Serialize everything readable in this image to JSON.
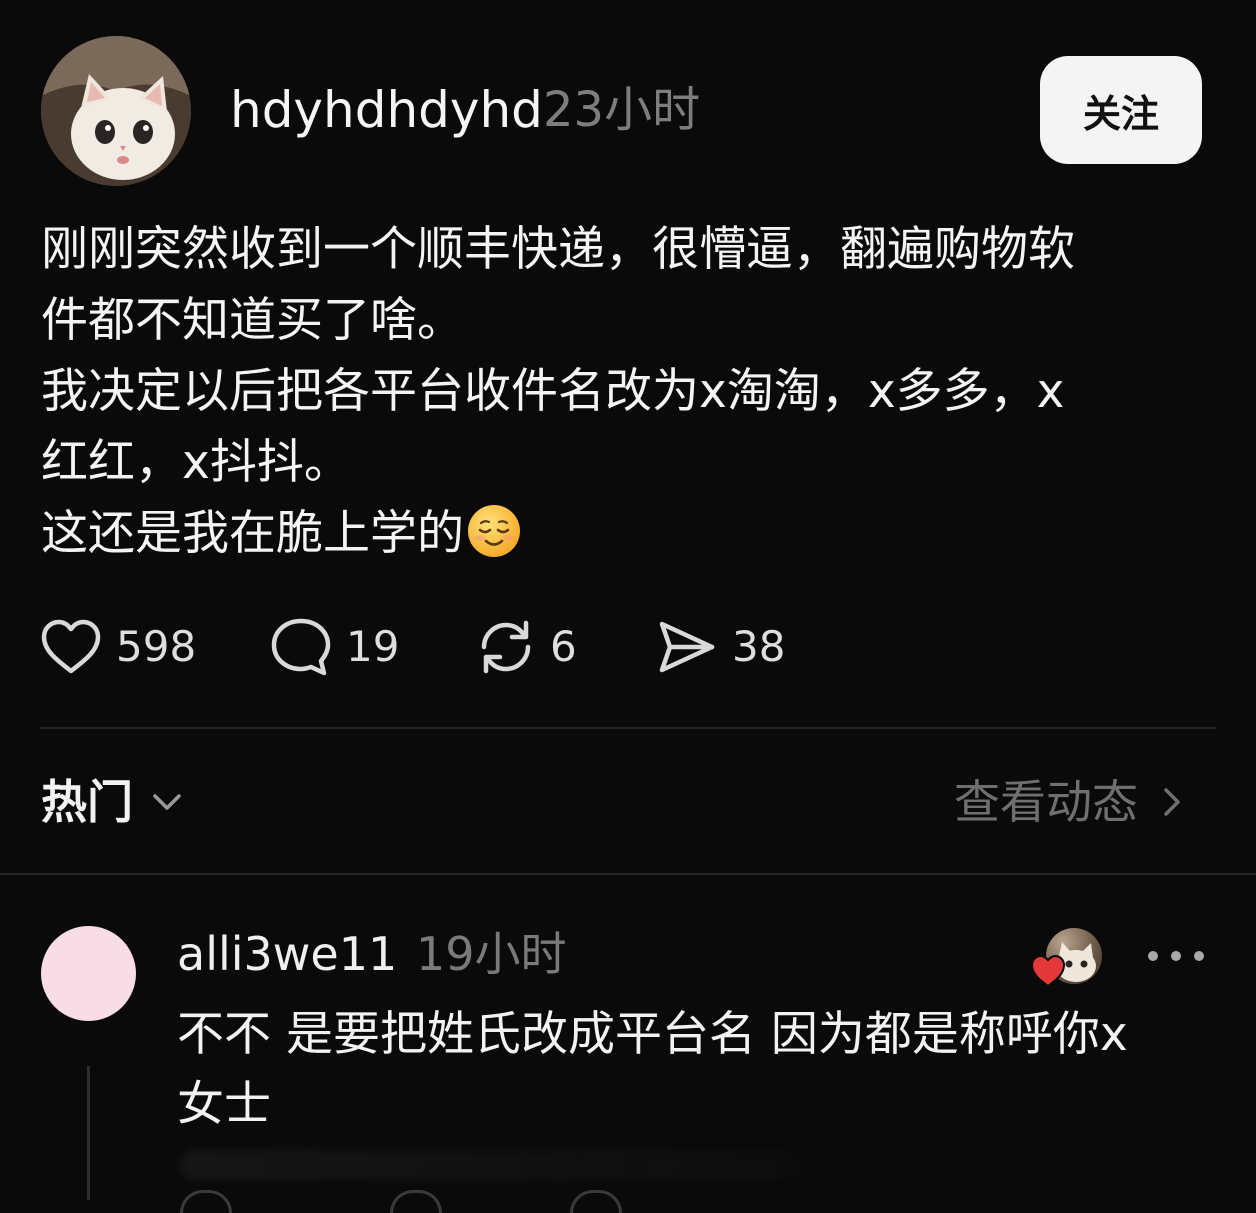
{
  "post": {
    "author": {
      "username": "hdyhdhdyhd",
      "time": "23小时"
    },
    "follow_label": "关注",
    "body_lines": [
      "刚刚突然收到一个顺丰快递，很懵逼，翻遍购物软",
      "件都不知道买了啥。",
      "我决定以后把各平台收件名改为x淘淘，x多多，x",
      "红红，x抖抖。",
      "这还是我在脆上学的"
    ],
    "emoji": "relieved-face",
    "stats": {
      "likes": "598",
      "comments": "19",
      "reposts": "6",
      "shares": "38"
    }
  },
  "sort": {
    "label": "热门",
    "activity_link": "查看动态"
  },
  "comment": {
    "username": "alli3we11",
    "time": "19小时",
    "text_lines": [
      "不不 是要把姓氏改成平台名 因为都是称呼你x",
      "女士"
    ]
  },
  "colors": {
    "background": "#0a0a0a",
    "text": "#f3f3f3",
    "muted": "#7d7d7d",
    "heart": "#e5383b",
    "comment_avatar": "#f8dde6"
  }
}
